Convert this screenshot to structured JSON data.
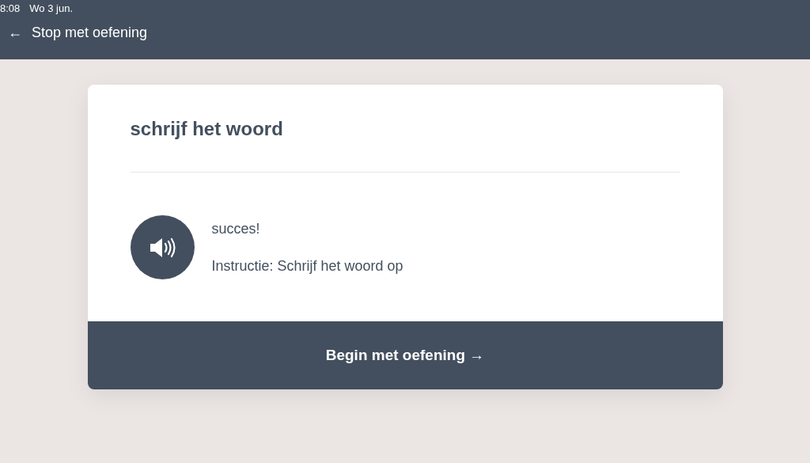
{
  "status_bar": {
    "time": "8:08",
    "date": "Wo 3 jun."
  },
  "nav": {
    "back_icon": "←",
    "label": "Stop met oefening"
  },
  "card": {
    "title": "schrijf het woord",
    "feedback": "succes!",
    "instruction": "Instructie: Schrijf het woord op",
    "button": "Begin met oefening →"
  }
}
